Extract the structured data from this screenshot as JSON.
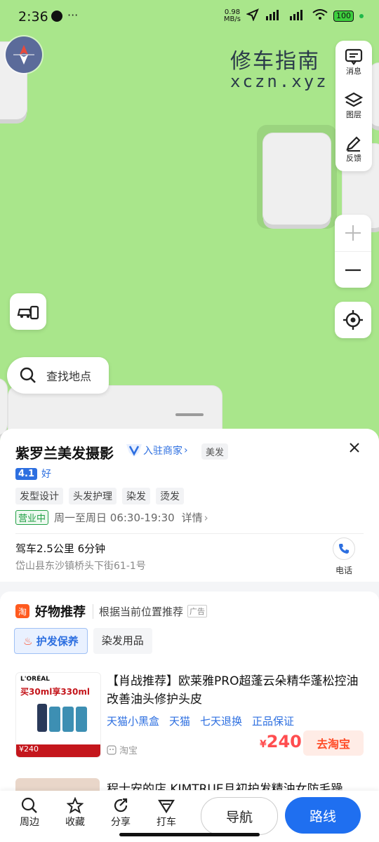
{
  "status": {
    "time": "2:36",
    "speed": "0.98",
    "speed_unit": "MB/s",
    "battery": "100",
    "more": "···"
  },
  "watermark": {
    "line1": "修车指南",
    "line2": "xczn.xyz"
  },
  "map_panel": {
    "message": "消息",
    "layers": "图层",
    "feedback": "反馈"
  },
  "search": {
    "placeholder": "查找地点"
  },
  "poi": {
    "name": "紫罗兰美发摄影",
    "badge": "入驻商家",
    "category": "美发",
    "rating": "4.1",
    "rating_word": "好",
    "tags": [
      "发型设计",
      "头发护理",
      "染发",
      "烫发"
    ],
    "open_status": "营业中",
    "hours": "周一至周日 06:30-19:30",
    "details": "详情",
    "drive": "驾车2.5公里 6分钟",
    "address": "岱山县东沙镇桥头下街61-1号",
    "phone_label": "电话"
  },
  "recommend": {
    "icon": "淘",
    "title": "好物推荐",
    "subtitle": "根据当前位置推荐",
    "ad": "广告",
    "tabs": [
      "护发保养",
      "染发用品"
    ],
    "product": {
      "title": "【肖战推荐】欧莱雅PRO超蓬云朵精华蓬松控油改善油头修护头皮",
      "tags": [
        "天猫小黑盒",
        "天猫",
        "七天退换",
        "正品保证"
      ],
      "source": "淘宝",
      "price_symbol": "¥",
      "price": "240",
      "button": "去淘宝",
      "img_brand": "L'ORÉAL",
      "img_promo": "买30ml享330ml",
      "img_price": "240"
    },
    "product2": {
      "title": "程士安的店 KIMTRUE且初护发精油女防毛躁"
    }
  },
  "bottom": {
    "nearby": "周边",
    "favorite": "收藏",
    "share": "分享",
    "taxi": "打车",
    "navigate": "导航",
    "route": "路线"
  }
}
